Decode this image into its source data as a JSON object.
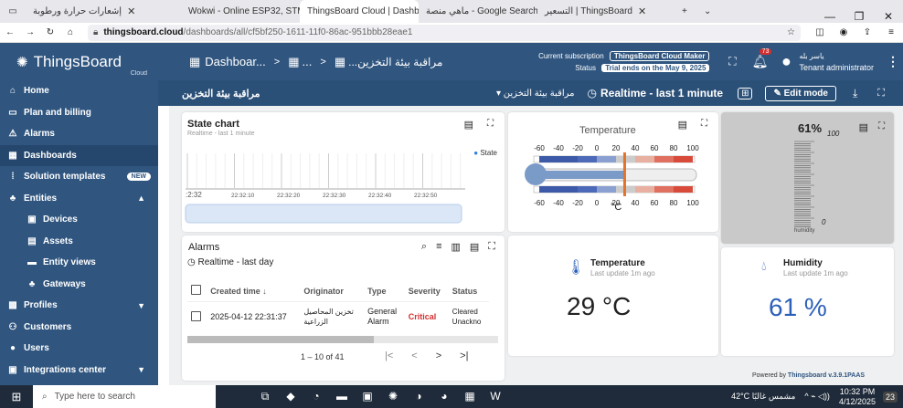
{
  "browser": {
    "tabs": [
      {
        "label": "إشعارات حرارة ورطوبة",
        "active": false
      },
      {
        "label": "Wokwi - Online ESP32, STM3",
        "active": false
      },
      {
        "label": "ThingsBoard Cloud | Dashboa",
        "active": true
      },
      {
        "label": "ماهي منصة - Google Search",
        "active": false
      },
      {
        "label": "التسعير | ThingsBoard",
        "active": false
      }
    ],
    "url_host": "thingsboard.cloud",
    "url_path": "/dashboards/all/cf5bf250-1611-11f0-86ac-951bbb28eae1"
  },
  "sidebar": {
    "logo": "ThingsBoard",
    "logo_sub": "Cloud",
    "items": [
      {
        "label": "Home",
        "icon": "home-icon",
        "glyph": "⌂"
      },
      {
        "label": "Plan and billing",
        "icon": "billing-icon",
        "glyph": "▭"
      },
      {
        "label": "Alarms",
        "icon": "alarm-icon",
        "glyph": "⚠"
      },
      {
        "label": "Dashboards",
        "icon": "dashboard-icon",
        "glyph": "▦",
        "active": true
      },
      {
        "label": "Solution templates",
        "icon": "templates-icon",
        "glyph": "⁞",
        "badge": "NEW"
      },
      {
        "label": "Entities",
        "icon": "entities-icon",
        "glyph": "♣",
        "chevron": "▲"
      },
      {
        "label": "Devices",
        "icon": "devices-icon",
        "glyph": "▣",
        "sub": true
      },
      {
        "label": "Assets",
        "icon": "assets-icon",
        "glyph": "▤",
        "sub": true
      },
      {
        "label": "Entity views",
        "icon": "entity-views-icon",
        "glyph": "▬",
        "sub": true
      },
      {
        "label": "Gateways",
        "icon": "gateways-icon",
        "glyph": "♣",
        "sub": true
      },
      {
        "label": "Profiles",
        "icon": "profiles-icon",
        "glyph": "▩",
        "chevron": "▼"
      },
      {
        "label": "Customers",
        "icon": "customers-icon",
        "glyph": "⚇"
      },
      {
        "label": "Users",
        "icon": "users-icon",
        "glyph": "●"
      },
      {
        "label": "Integrations center",
        "icon": "integrations-icon",
        "glyph": "▣",
        "chevron": "▼"
      }
    ]
  },
  "header": {
    "breadcrumb_1": "Dashboar...",
    "breadcrumb_2": "...",
    "breadcrumb_3": "...مراقبة بيئة التخزين",
    "subscription_label": "Current subscription",
    "plan": "ThingsBoard Cloud Maker",
    "status_label": "Status",
    "trial": "Trial ends on the May 9, 2025",
    "notif_count": "73",
    "user_name": "ياسر بله",
    "user_role": "Tenant administrator"
  },
  "dashbar": {
    "title": "مراقبة بيئة التخزين",
    "state_select": "مراقبة بيئة التخزين",
    "time": "Realtime - last 1 minute",
    "edit": "Edit mode"
  },
  "state_chart": {
    "title": "State chart",
    "subtitle": "Realtime - last 1 minute",
    "legend": "State",
    "ticks": [
      ":2:32",
      "22:32:10",
      "22:32:20",
      "22:32:30",
      "22:32:40",
      "22:32:50"
    ]
  },
  "thermo": {
    "title": "Temperature",
    "scale": [
      "-60",
      "-40",
      "-20",
      "0",
      "20",
      "40",
      "60",
      "80",
      "100"
    ],
    "unit": "°C",
    "value": 29
  },
  "humidity_gauge": {
    "value": "61%",
    "max": "100",
    "min": "0",
    "label": "humidity"
  },
  "alarms": {
    "title": "Alarms",
    "time": "Realtime - last day",
    "columns": [
      "Created time",
      "Originator",
      "Type",
      "Severity",
      "Status"
    ],
    "row": {
      "time": "2025-04-12 22:31:37",
      "originator_1": "تخزين المحاصيل",
      "originator_2": "الزراعية",
      "type_1": "General",
      "type_2": "Alarm",
      "severity": "Critical",
      "status_1": "Cleared",
      "status_2": "Unackno"
    },
    "pagination": "1 – 10 of 41"
  },
  "temp_card": {
    "title": "Temperature",
    "sub": "Last update 1m ago",
    "value": "29 °C"
  },
  "hum_card": {
    "title": "Humidity",
    "sub": "Last update 1m ago",
    "value": "61 %"
  },
  "footer": {
    "powered": "Powered by ",
    "brand": "Thingsboard v.3.9.1PAAS"
  },
  "taskbar": {
    "search": "Type here to search",
    "weather": "42°C  مشمس غالبًا",
    "time": "10:32 PM",
    "date": "4/12/2025",
    "notif": "23"
  },
  "colors": {
    "sidebar": "#305680",
    "accent": "#305680",
    "critical": "#d32f2f",
    "value_blue": "#2c5fb8"
  }
}
